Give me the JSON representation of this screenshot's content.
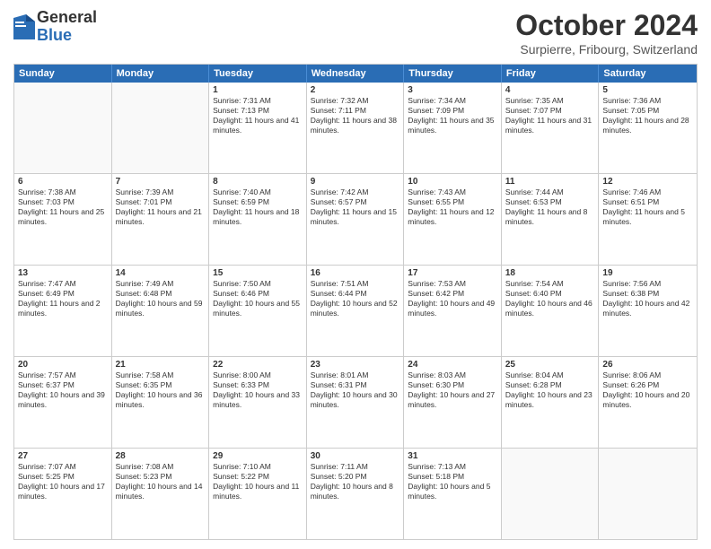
{
  "logo": {
    "general": "General",
    "blue": "Blue"
  },
  "title": "October 2024",
  "subtitle": "Surpierre, Fribourg, Switzerland",
  "days_of_week": [
    "Sunday",
    "Monday",
    "Tuesday",
    "Wednesday",
    "Thursday",
    "Friday",
    "Saturday"
  ],
  "rows": [
    [
      {
        "day": "",
        "empty": true
      },
      {
        "day": "",
        "empty": true
      },
      {
        "day": "1",
        "sunrise": "Sunrise: 7:31 AM",
        "sunset": "Sunset: 7:13 PM",
        "daylight": "Daylight: 11 hours and 41 minutes."
      },
      {
        "day": "2",
        "sunrise": "Sunrise: 7:32 AM",
        "sunset": "Sunset: 7:11 PM",
        "daylight": "Daylight: 11 hours and 38 minutes."
      },
      {
        "day": "3",
        "sunrise": "Sunrise: 7:34 AM",
        "sunset": "Sunset: 7:09 PM",
        "daylight": "Daylight: 11 hours and 35 minutes."
      },
      {
        "day": "4",
        "sunrise": "Sunrise: 7:35 AM",
        "sunset": "Sunset: 7:07 PM",
        "daylight": "Daylight: 11 hours and 31 minutes."
      },
      {
        "day": "5",
        "sunrise": "Sunrise: 7:36 AM",
        "sunset": "Sunset: 7:05 PM",
        "daylight": "Daylight: 11 hours and 28 minutes."
      }
    ],
    [
      {
        "day": "6",
        "sunrise": "Sunrise: 7:38 AM",
        "sunset": "Sunset: 7:03 PM",
        "daylight": "Daylight: 11 hours and 25 minutes."
      },
      {
        "day": "7",
        "sunrise": "Sunrise: 7:39 AM",
        "sunset": "Sunset: 7:01 PM",
        "daylight": "Daylight: 11 hours and 21 minutes."
      },
      {
        "day": "8",
        "sunrise": "Sunrise: 7:40 AM",
        "sunset": "Sunset: 6:59 PM",
        "daylight": "Daylight: 11 hours and 18 minutes."
      },
      {
        "day": "9",
        "sunrise": "Sunrise: 7:42 AM",
        "sunset": "Sunset: 6:57 PM",
        "daylight": "Daylight: 11 hours and 15 minutes."
      },
      {
        "day": "10",
        "sunrise": "Sunrise: 7:43 AM",
        "sunset": "Sunset: 6:55 PM",
        "daylight": "Daylight: 11 hours and 12 minutes."
      },
      {
        "day": "11",
        "sunrise": "Sunrise: 7:44 AM",
        "sunset": "Sunset: 6:53 PM",
        "daylight": "Daylight: 11 hours and 8 minutes."
      },
      {
        "day": "12",
        "sunrise": "Sunrise: 7:46 AM",
        "sunset": "Sunset: 6:51 PM",
        "daylight": "Daylight: 11 hours and 5 minutes."
      }
    ],
    [
      {
        "day": "13",
        "sunrise": "Sunrise: 7:47 AM",
        "sunset": "Sunset: 6:49 PM",
        "daylight": "Daylight: 11 hours and 2 minutes."
      },
      {
        "day": "14",
        "sunrise": "Sunrise: 7:49 AM",
        "sunset": "Sunset: 6:48 PM",
        "daylight": "Daylight: 10 hours and 59 minutes."
      },
      {
        "day": "15",
        "sunrise": "Sunrise: 7:50 AM",
        "sunset": "Sunset: 6:46 PM",
        "daylight": "Daylight: 10 hours and 55 minutes."
      },
      {
        "day": "16",
        "sunrise": "Sunrise: 7:51 AM",
        "sunset": "Sunset: 6:44 PM",
        "daylight": "Daylight: 10 hours and 52 minutes."
      },
      {
        "day": "17",
        "sunrise": "Sunrise: 7:53 AM",
        "sunset": "Sunset: 6:42 PM",
        "daylight": "Daylight: 10 hours and 49 minutes."
      },
      {
        "day": "18",
        "sunrise": "Sunrise: 7:54 AM",
        "sunset": "Sunset: 6:40 PM",
        "daylight": "Daylight: 10 hours and 46 minutes."
      },
      {
        "day": "19",
        "sunrise": "Sunrise: 7:56 AM",
        "sunset": "Sunset: 6:38 PM",
        "daylight": "Daylight: 10 hours and 42 minutes."
      }
    ],
    [
      {
        "day": "20",
        "sunrise": "Sunrise: 7:57 AM",
        "sunset": "Sunset: 6:37 PM",
        "daylight": "Daylight: 10 hours and 39 minutes."
      },
      {
        "day": "21",
        "sunrise": "Sunrise: 7:58 AM",
        "sunset": "Sunset: 6:35 PM",
        "daylight": "Daylight: 10 hours and 36 minutes."
      },
      {
        "day": "22",
        "sunrise": "Sunrise: 8:00 AM",
        "sunset": "Sunset: 6:33 PM",
        "daylight": "Daylight: 10 hours and 33 minutes."
      },
      {
        "day": "23",
        "sunrise": "Sunrise: 8:01 AM",
        "sunset": "Sunset: 6:31 PM",
        "daylight": "Daylight: 10 hours and 30 minutes."
      },
      {
        "day": "24",
        "sunrise": "Sunrise: 8:03 AM",
        "sunset": "Sunset: 6:30 PM",
        "daylight": "Daylight: 10 hours and 27 minutes."
      },
      {
        "day": "25",
        "sunrise": "Sunrise: 8:04 AM",
        "sunset": "Sunset: 6:28 PM",
        "daylight": "Daylight: 10 hours and 23 minutes."
      },
      {
        "day": "26",
        "sunrise": "Sunrise: 8:06 AM",
        "sunset": "Sunset: 6:26 PM",
        "daylight": "Daylight: 10 hours and 20 minutes."
      }
    ],
    [
      {
        "day": "27",
        "sunrise": "Sunrise: 7:07 AM",
        "sunset": "Sunset: 5:25 PM",
        "daylight": "Daylight: 10 hours and 17 minutes."
      },
      {
        "day": "28",
        "sunrise": "Sunrise: 7:08 AM",
        "sunset": "Sunset: 5:23 PM",
        "daylight": "Daylight: 10 hours and 14 minutes."
      },
      {
        "day": "29",
        "sunrise": "Sunrise: 7:10 AM",
        "sunset": "Sunset: 5:22 PM",
        "daylight": "Daylight: 10 hours and 11 minutes."
      },
      {
        "day": "30",
        "sunrise": "Sunrise: 7:11 AM",
        "sunset": "Sunset: 5:20 PM",
        "daylight": "Daylight: 10 hours and 8 minutes."
      },
      {
        "day": "31",
        "sunrise": "Sunrise: 7:13 AM",
        "sunset": "Sunset: 5:18 PM",
        "daylight": "Daylight: 10 hours and 5 minutes."
      },
      {
        "day": "",
        "empty": true
      },
      {
        "day": "",
        "empty": true
      }
    ]
  ]
}
